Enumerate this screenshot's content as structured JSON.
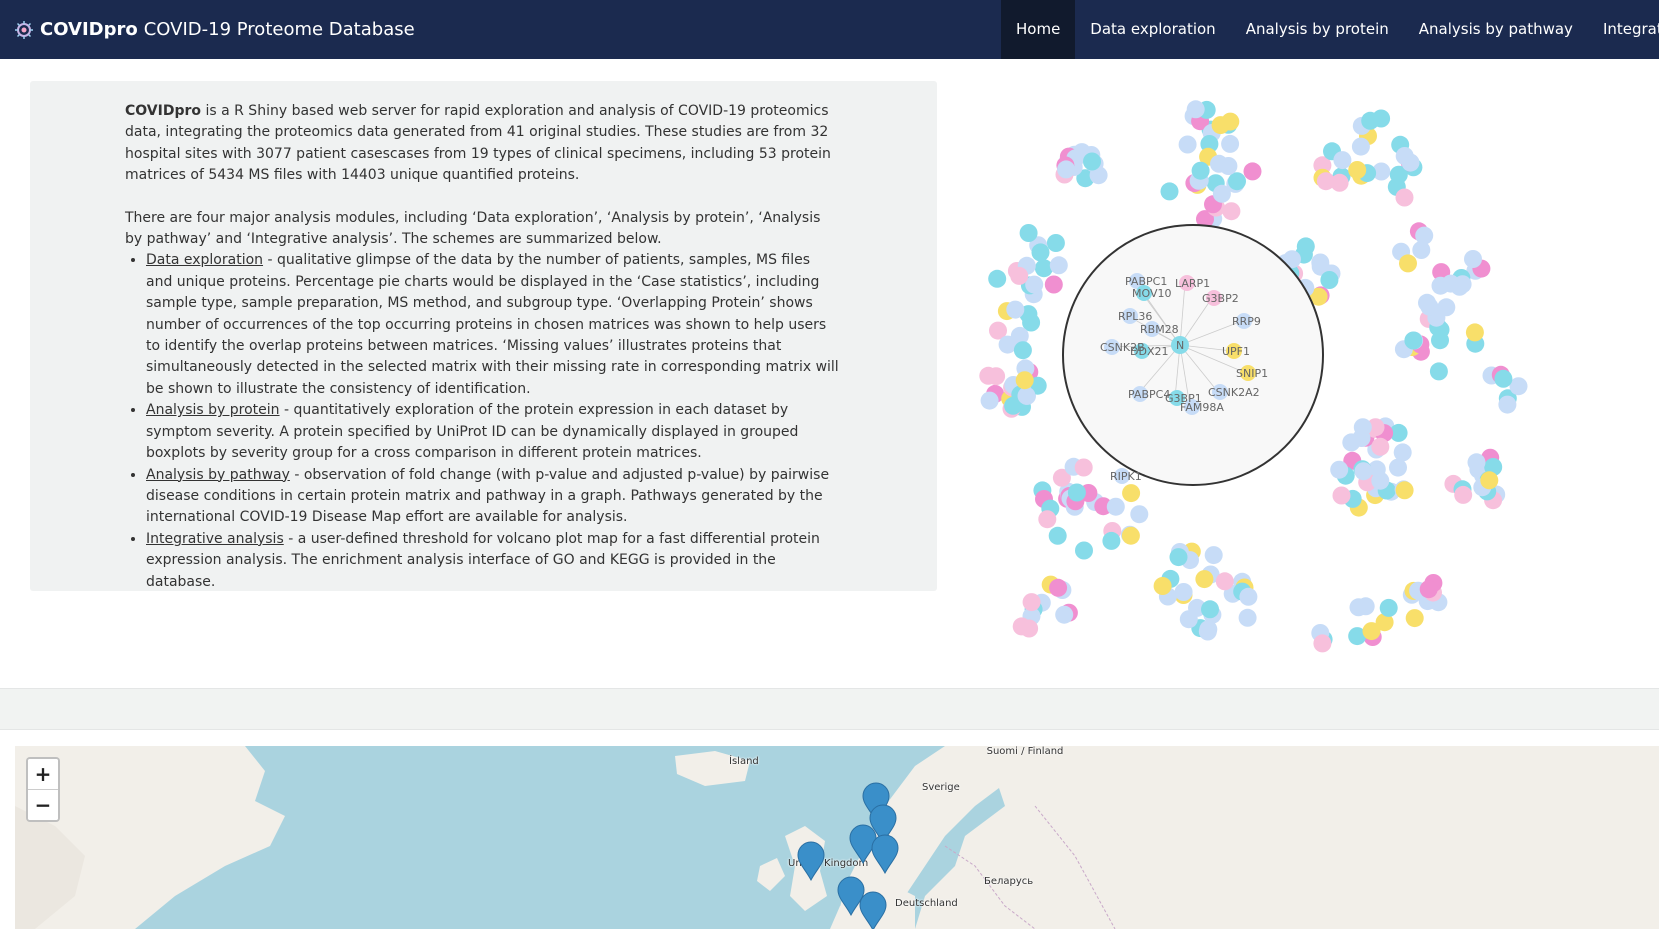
{
  "navbar": {
    "brand_bold": "COVIDpro",
    "brand_rest": "COVID-19 Proteome Database",
    "logo_icon": "virus-logo-icon",
    "items": [
      {
        "label": "Home",
        "active": true
      },
      {
        "label": "Data exploration",
        "active": false
      },
      {
        "label": "Analysis by protein",
        "active": false
      },
      {
        "label": "Analysis by pathway",
        "active": false
      },
      {
        "label": "Integrative analysis",
        "active": false
      }
    ]
  },
  "intro": {
    "lead_bold": "COVIDpro",
    "lead_text": " is a R Shiny based web server for rapid exploration and analysis of COVID-19 proteomics data, integrating the proteomics data generated from 41 original studies. These studies are from 32 hospital sites with 3077 patient casescases from 19 types of clinical specimens, including 53 protein matrices of 5434 MS files with 14403 unique quantified proteins.",
    "modules_text": "There are four major analysis modules, including ‘Data exploration’, ‘Analysis by protein’, ‘Analysis by pathway’ and ‘Integrative analysis’. The schemes are summarized below.",
    "bullets": [
      {
        "link": "Data exploration",
        "text": " - qualitative glimpse of the data by the number of patients, samples, MS files and unique proteins. Percentage pie charts would be displayed in the ‘Case statistics’, including sample type, sample preparation, MS method, and subgroup type. ‘Overlapping Protein’ shows number of occurrences of the top occurring proteins in chosen matrices was shown to help users to identify the overlap proteins between matrices. ‘Missing values’ illustrates proteins that simultaneously detected in the selected matrix with their missing rate in corresponding matrix will be shown to illustrate the consistency of identification."
      },
      {
        "link": "Analysis by protein",
        "text": " - quantitatively exploration of the protein expression in each dataset by symptom severity. A protein specified by UniProt ID can be dynamically displayed in grouped boxplots by severity group for a cross comparison in different protein matrices."
      },
      {
        "link": "Analysis by pathway",
        "text": " - observation of fold change (with p-value and adjusted p-value) by pairwise disease conditions in certain protein matrix and pathway in a graph. Pathways generated by the international COVID-19 Disease Map effort are available for analysis."
      },
      {
        "link": "Integrative analysis",
        "text": " - a user-defined threshold for volcano plot map for a fast differential protein expression analysis. The enrichment analysis interface of GO and KEGG is provided in the database."
      }
    ]
  },
  "network": {
    "center_node": "N",
    "labels": [
      "PABPC1",
      "LARP1",
      "MOV10",
      "G3BP2",
      "RPL36",
      "RRP9",
      "RBM28",
      "CSNK2B",
      "DDX21",
      "UPF1",
      "SNIP1",
      "PABPC4",
      "CSNK2A2",
      "G3BP1",
      "FAM98A",
      "RIPK1"
    ],
    "colors": {
      "lightblue": "#c7dcf7",
      "cyan": "#86dbe9",
      "pink": "#f7c0dc",
      "magenta": "#f08fd0",
      "yellow": "#f8df6a"
    }
  },
  "map": {
    "zoom_in": "+",
    "zoom_out": "−",
    "labels": [
      "Ísland",
      "Suomi / Finland",
      "Sverige",
      "United Kingdom",
      "Беларусь",
      "Deutschland"
    ],
    "marker_color": "#3a8fc9"
  }
}
